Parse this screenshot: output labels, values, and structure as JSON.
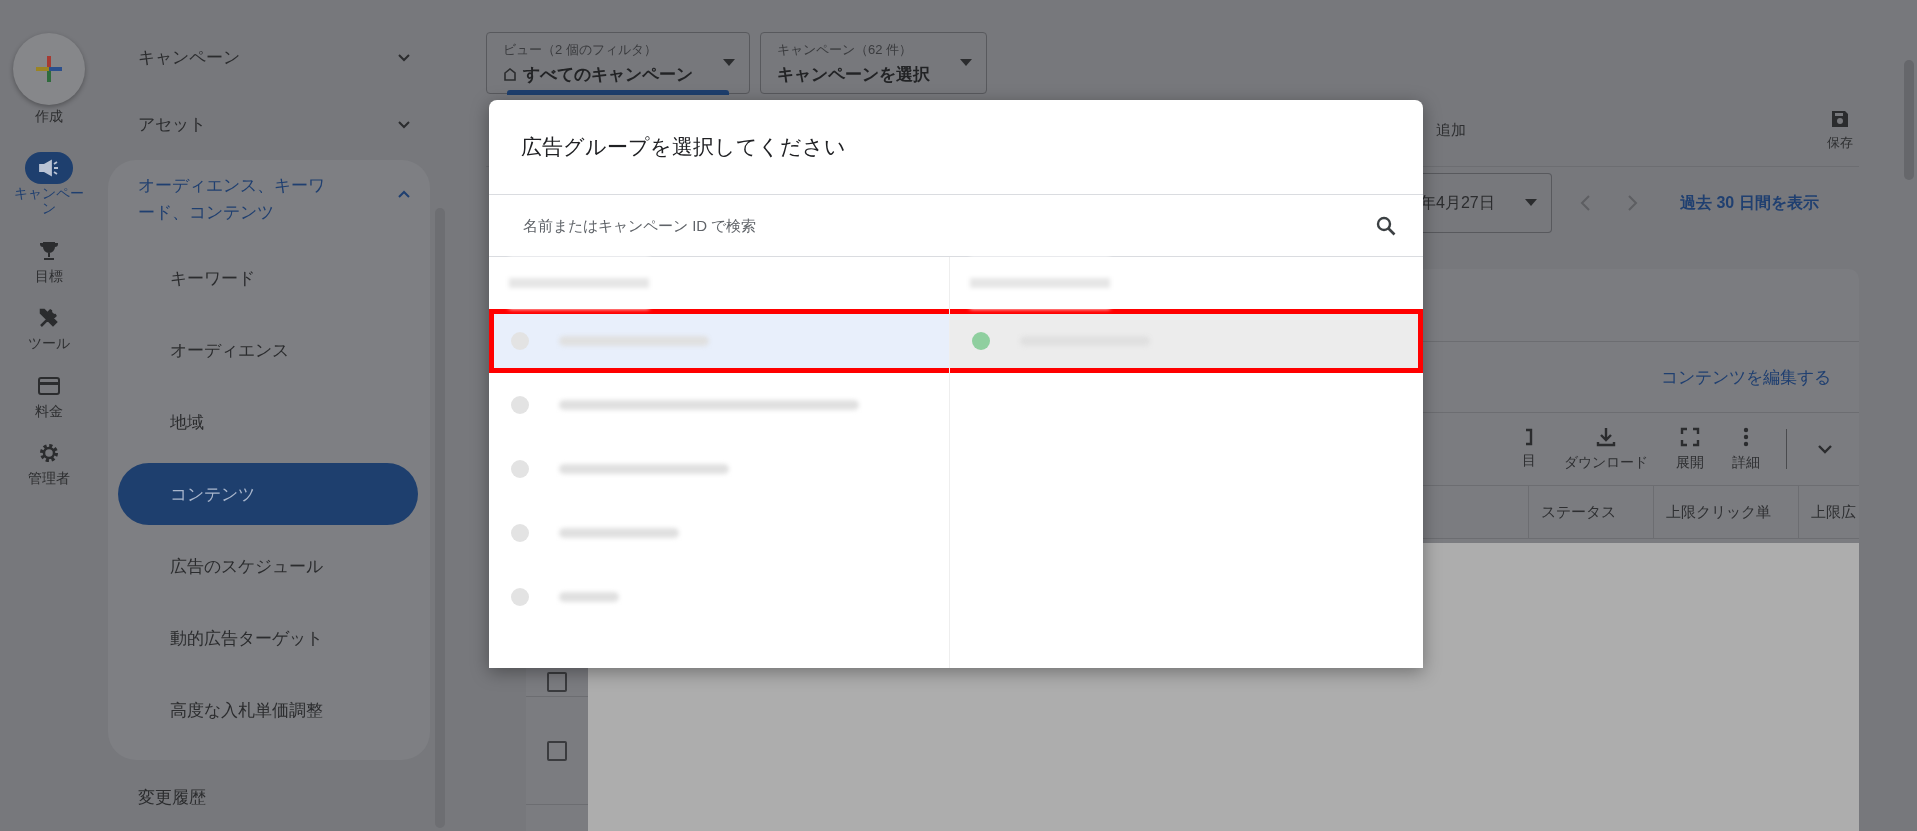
{
  "rail": {
    "create": {
      "label": "作成"
    },
    "items": [
      {
        "label": "キャンペーン",
        "kind": "megaphone",
        "selected": true
      },
      {
        "label": "目標",
        "kind": "trophy",
        "selected": false
      },
      {
        "label": "ツール",
        "kind": "tools",
        "selected": false
      },
      {
        "label": "料金",
        "kind": "card",
        "selected": false
      },
      {
        "label": "管理者",
        "kind": "gear",
        "selected": false
      }
    ]
  },
  "sidebar": {
    "items": [
      {
        "label": "キャンペーン",
        "expanded": false
      },
      {
        "label": "アセット",
        "expanded": false
      },
      {
        "label": "オーディエンス、キーワード、コンテンツ",
        "expanded": true,
        "children": [
          {
            "label": "キーワード",
            "selected": false
          },
          {
            "label": "オーディエンス",
            "selected": false
          },
          {
            "label": "地域",
            "selected": false
          },
          {
            "label": "コンテンツ",
            "selected": true
          },
          {
            "label": "広告のスケジュール",
            "selected": false
          },
          {
            "label": "動的広告ターゲット",
            "selected": false
          },
          {
            "label": "高度な入札単価調整",
            "selected": false
          }
        ]
      },
      {
        "label": "変更履歴"
      }
    ]
  },
  "filters": [
    {
      "caption": "ビュー（2 個のフィルタ）",
      "value": "すべてのキャンペーン",
      "kind": "view"
    },
    {
      "caption": "キャンペーン（62 件）",
      "value": "キャンペーンを選択",
      "kind": "campaign"
    }
  ],
  "toolbar": {
    "add_label": "追加",
    "save_label": "保存"
  },
  "date_bar": {
    "date": "年4月27日",
    "show_last": "過去 30 日間を表示"
  },
  "card": {
    "edit_link": "コンテンツを編集する",
    "actions": [
      {
        "label": "目",
        "kind": "columns"
      },
      {
        "label": "ダウンロード",
        "kind": "download"
      },
      {
        "label": "展開",
        "kind": "expand"
      },
      {
        "label": "詳細",
        "kind": "more"
      }
    ],
    "columns": [
      "ステータス",
      "上限クリック単",
      "上限広"
    ],
    "rows": [
      {
        "checked": false
      },
      {
        "checked": false
      }
    ]
  },
  "dialog": {
    "title": "広告グループを選択してください",
    "search_placeholder": "名前またはキャンペーン ID で検索",
    "left_rows": [
      {
        "selected": true,
        "highlighted": true
      },
      {
        "selected": false,
        "highlighted": false
      },
      {
        "selected": false,
        "highlighted": false
      },
      {
        "selected": false,
        "highlighted": false
      },
      {
        "selected": false,
        "highlighted": false
      }
    ],
    "right_rows": [
      {
        "color": "#8fcf9f",
        "selected": true,
        "highlighted": true
      }
    ]
  }
}
